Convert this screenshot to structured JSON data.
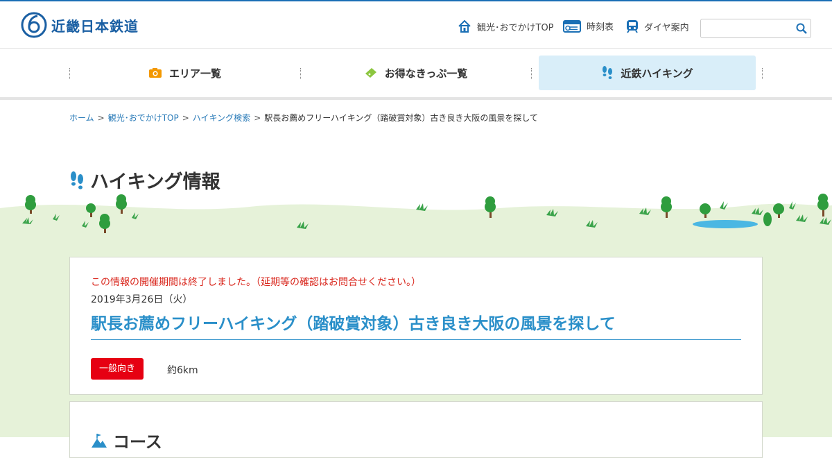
{
  "header": {
    "logo_text": "近畿日本鉄道",
    "links": [
      {
        "label": "観光･おでかけTOP",
        "icon": "home-icon"
      },
      {
        "label": "時刻表",
        "icon": "timetable-icon"
      },
      {
        "label": "ダイヤ案内",
        "icon": "train-icon"
      }
    ],
    "search": {
      "placeholder": "",
      "value": ""
    }
  },
  "nav": {
    "items": [
      {
        "label": "エリア一覧",
        "icon": "camera-icon",
        "color": "#f39800"
      },
      {
        "label": "お得なきっぷ一覧",
        "icon": "ticket-icon",
        "color": "#8cc63f"
      },
      {
        "label": "近鉄ハイキング",
        "icon": "footprints-icon",
        "color": "#2a8fc9"
      }
    ]
  },
  "breadcrumb": {
    "items": [
      "ホーム",
      "観光･おでかけTOP",
      "ハイキング検索"
    ],
    "current": "駅長お薦めフリーハイキング（踏破賞対象）古き良き大阪の風景を探して"
  },
  "page_title": "ハイキング情報",
  "event": {
    "notice": "この情報の開催期間は終了しました。（延期等の確認はお問合せください。）",
    "date": "2019年3月26日（火）",
    "title": "駅長お薦めフリーハイキング（踏破賞対象）古き良き大阪の風景を探して",
    "level_badge": "一般向き",
    "distance": "約6km"
  },
  "course": {
    "heading": "コース"
  },
  "colors": {
    "brand": "#1a5fa3",
    "link": "#2a7bb8",
    "title_blue": "#2a8fc9",
    "notice_red": "#d9261c",
    "badge_red": "#e60012",
    "meadow": "#e6f2d9"
  }
}
